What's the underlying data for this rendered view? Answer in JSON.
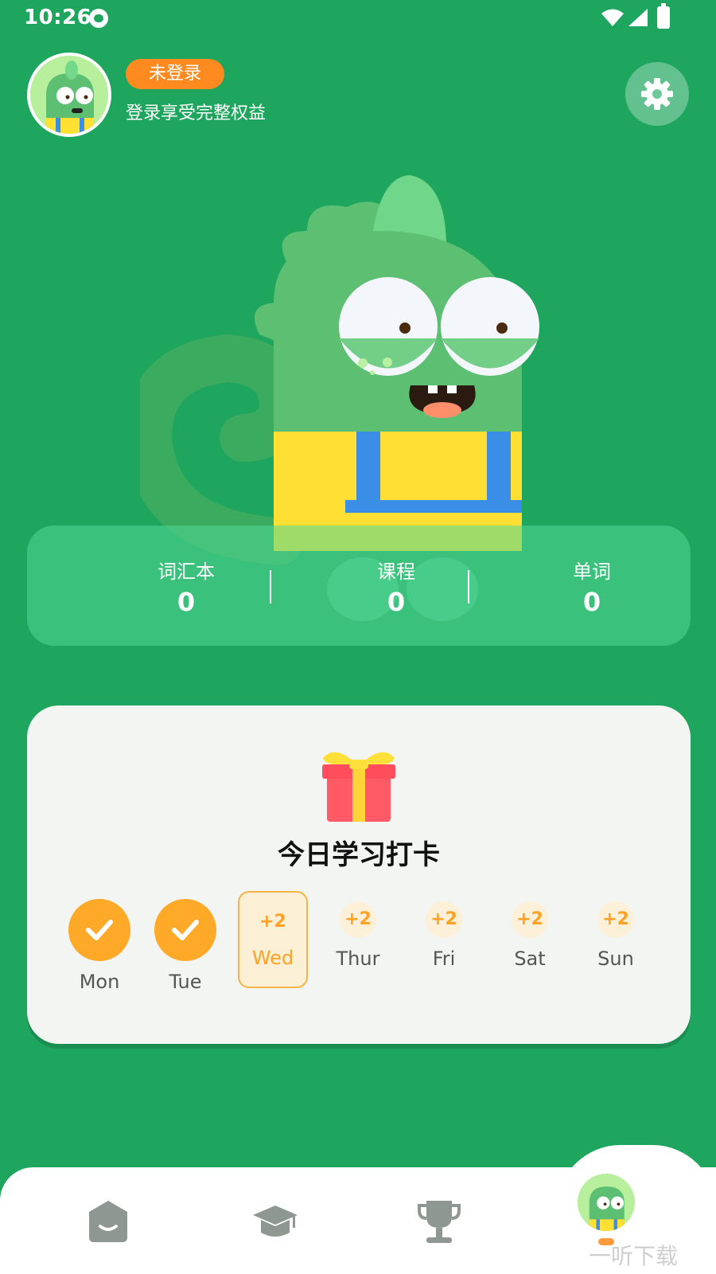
{
  "status_bar": {
    "time": "10:26"
  },
  "profile": {
    "login_badge": "未登录",
    "subtitle": "登录享受完整权益"
  },
  "stats": [
    {
      "label": "词汇本",
      "value": "0"
    },
    {
      "label": "课程",
      "value": "0"
    },
    {
      "label": "单词",
      "value": "0"
    }
  ],
  "checkin": {
    "title": "今日学习打卡",
    "days": [
      {
        "name": "Mon",
        "state": "checked"
      },
      {
        "name": "Tue",
        "state": "checked"
      },
      {
        "name": "Wed",
        "state": "today",
        "reward": "+2"
      },
      {
        "name": "Thur",
        "state": "upcoming",
        "reward": "+2"
      },
      {
        "name": "Fri",
        "state": "upcoming",
        "reward": "+2"
      },
      {
        "name": "Sat",
        "state": "upcoming",
        "reward": "+2"
      },
      {
        "name": "Sun",
        "state": "upcoming",
        "reward": "+2"
      }
    ]
  },
  "bottom_nav": {
    "items": [
      {
        "icon": "home-icon"
      },
      {
        "icon": "graduation-cap-icon"
      },
      {
        "icon": "trophy-icon"
      },
      {
        "icon": "profile-avatar-icon"
      }
    ]
  },
  "watermark": "一听下载",
  "colors": {
    "background": "#1fa65e",
    "accent_orange": "#ffa928",
    "badge_orange": "#ff8a1f"
  }
}
